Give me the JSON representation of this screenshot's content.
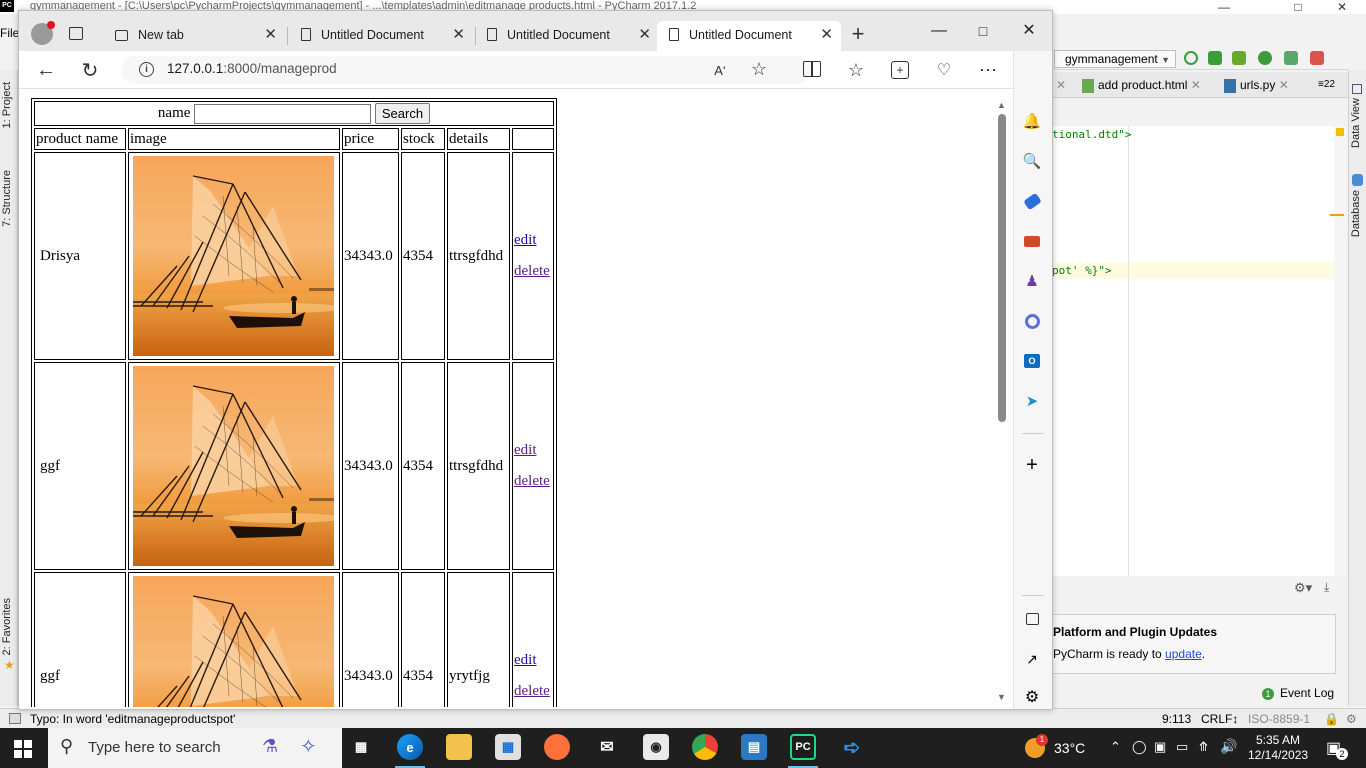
{
  "pycharm": {
    "title": "gymmanagement - [C:\\Users\\pc\\PycharmProjects\\gymmanagement] - ...\\templates\\admin\\editmanage products.html - PyCharm 2017.1.2",
    "menu_first": "File",
    "left_tools": [
      "1: Project",
      "7: Structure",
      "2: Favorites"
    ],
    "right_tools": [
      "Data View",
      "Database"
    ],
    "run_config": "gymmanagement",
    "editor_tabs": [
      "add product.html",
      "urls.py"
    ],
    "tab_overflow": "≡22",
    "code_lines": [
      "tional.dtd\">",
      "pot' %}\">"
    ],
    "notification": {
      "title": "Platform and Plugin Updates",
      "message_prefix": "PyCharm is ready to ",
      "link": "update",
      "suffix": "."
    },
    "event_log": "Event Log",
    "event_count": "1",
    "status_message": "Typo: In word 'editmanageproductspot'",
    "status_position": "9:113",
    "status_lf": "CRLF↕",
    "status_encoding": "ISO-8859-1"
  },
  "edge": {
    "tabs": [
      {
        "label": "New tab"
      },
      {
        "label": "Untitled Document"
      },
      {
        "label": "Untitled Document"
      },
      {
        "label": "Untitled Document"
      }
    ],
    "active_tab_index": 3,
    "url_host": "127.0.0.1",
    "url_rest": ":8000/manageprod"
  },
  "page": {
    "search_label": "name",
    "search_value": "",
    "search_button": "Search",
    "headers": [
      "product name",
      "image",
      "price",
      "stock",
      "details",
      ""
    ],
    "rows": [
      {
        "name": "Drisya",
        "price": "34343.0",
        "stock": "4354",
        "details": "ttrsgfdhd",
        "edit": "edit",
        "delete": "delete"
      },
      {
        "name": "ggf",
        "price": "34343.0",
        "stock": "4354",
        "details": "ttrsgfdhd",
        "edit": "edit",
        "delete": "delete"
      },
      {
        "name": "ggf",
        "price": "34343.0",
        "stock": "4354",
        "details": "yrytfjg",
        "edit": "edit",
        "delete": "delete"
      }
    ]
  },
  "taskbar": {
    "search_placeholder": "Type here to search",
    "weather": "33°C",
    "time": "5:35 AM",
    "date": "12/14/2023",
    "notif_count": "2"
  },
  "colors": {
    "edge_accent": "#0f6cbd",
    "pycharm_green": "#3c9c3c",
    "taskbar": "#1f1f1f"
  }
}
